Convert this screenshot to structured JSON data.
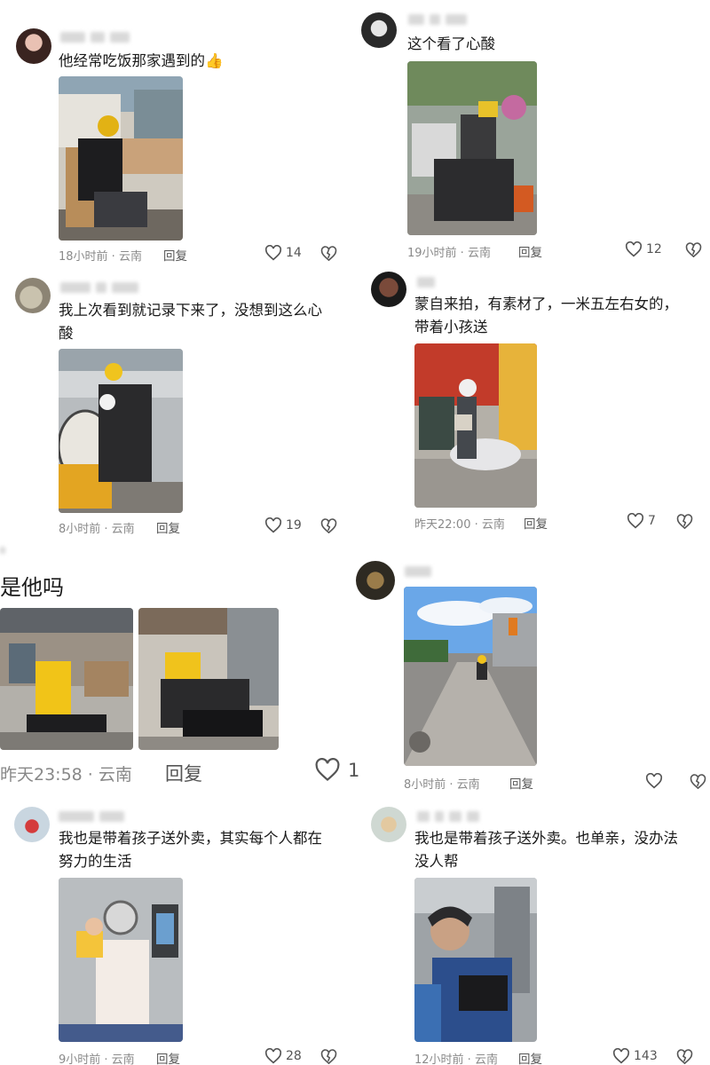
{
  "comments": [
    {
      "text": "他经常吃饭那家遇到的👍",
      "time": "18小时前 · 云南",
      "reply": "回复",
      "likes": "14"
    },
    {
      "text": "这个看了心酸",
      "time": "19小时前 · 云南",
      "reply": "回复",
      "likes": "12"
    },
    {
      "text": "我上次看到就记录下来了，没想到这么心酸",
      "time": "8小时前 · 云南",
      "reply": "回复",
      "likes": "19"
    },
    {
      "text": "蒙自来拍，有素材了，一米五左右女的，带着小孩送",
      "time": "昨天22:00 · 云南",
      "reply": "回复",
      "likes": "7"
    },
    {
      "text": "是他吗",
      "time": "昨天23:58 · 云南",
      "reply": "回复",
      "likes": "1"
    },
    {
      "text": "",
      "time": "8小时前 · 云南",
      "reply": "回复",
      "likes": ""
    },
    {
      "text": "我也是带着孩子送外卖，其实每个人都在努力的生活",
      "time": "9小时前 · 云南",
      "reply": "回复",
      "likes": "28"
    },
    {
      "text": "我也是带着孩子送外卖。也单亲，没办法没人帮",
      "time": "12小时前 · 云南",
      "reply": "回复",
      "likes": "143"
    }
  ],
  "icons": {
    "like": "heart-outline-icon",
    "dislike": "broken-heart-icon"
  },
  "colors": {
    "meta": "#8a8a8a",
    "delivery_yellow": "#f2c200",
    "sky": "#6aa7e8"
  }
}
